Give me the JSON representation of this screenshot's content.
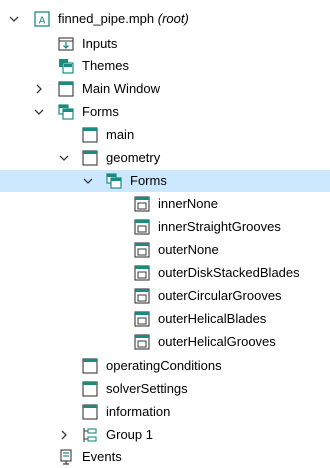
{
  "tree": {
    "root": {
      "label": "finned_pipe.mph",
      "suffix": "(root)"
    },
    "inputs": "Inputs",
    "themes": "Themes",
    "main_window": "Main Window",
    "forms": "Forms",
    "form_main": "main",
    "form_geometry": "geometry",
    "geometry_forms": "Forms",
    "geometry_children": [
      "innerNone",
      "innerStraightGrooves",
      "outerNone",
      "outerDiskStackedBlades",
      "outerCircularGrooves",
      "outerHelicalBlades",
      "outerHelicalGrooves"
    ],
    "form_operating": "operatingConditions",
    "form_solver": "solverSettings",
    "form_information": "information",
    "group1": "Group 1",
    "events": "Events"
  },
  "colors": {
    "selection": "#cce8ff",
    "icon_teal": "#1d8a80",
    "icon_dark": "#3a3a3a"
  }
}
